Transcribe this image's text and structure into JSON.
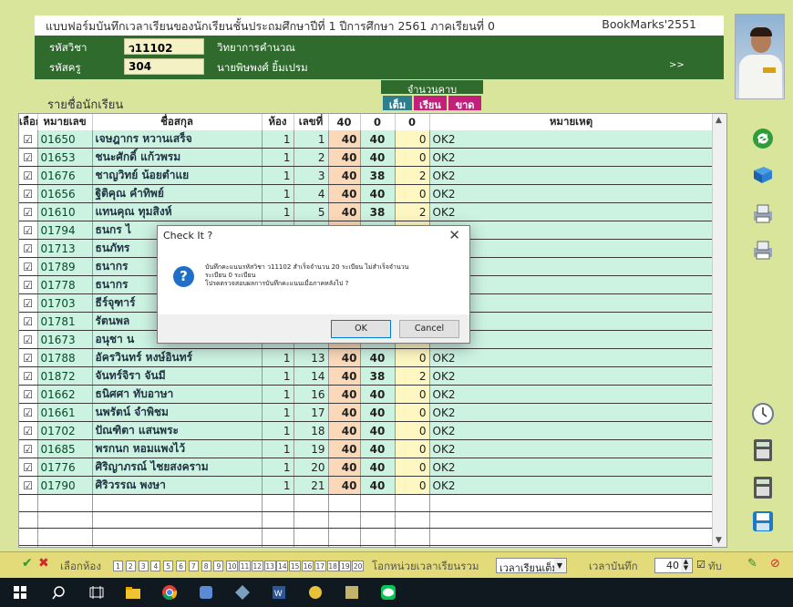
{
  "window": {
    "title": "แบบฟอร์มบันทึกเวลาเรียนของนักเรียนชั้นประถมศึกษาปีที่ 1   ปีการศึกษา 2561  ภาคเรียนที่ 0",
    "bookmark": "BookMarks'2551"
  },
  "header": {
    "subject_code_label": "รหัสวิชา",
    "subject_code": "ว11102",
    "subject_name": "วิทยาการคำนวณ",
    "teacher_code_label": "รหัสครู",
    "teacher_code": "304",
    "teacher_name": "นายพิษพงศ์ ยิ้มเปรม",
    "more_label": ">>"
  },
  "list_title": "รายชื่อนักเรียน",
  "periods": {
    "label": "จำนวนคาบ",
    "full_label": "เต็ม",
    "attend_label": "เรียน",
    "absent_label": "ขาด",
    "full_color": "#2e7f8d",
    "attend_color": "#c2207a",
    "absent_color": "#c2207a"
  },
  "columns": {
    "select": "เลือก",
    "id": "หมายเลข",
    "name": "ชื่อสกุล",
    "room": "ห้อง",
    "number": "เลขที่",
    "full": "40",
    "attend": "0",
    "absent": "0",
    "note": "หมายเหตุ"
  },
  "rows": [
    {
      "check": "☑",
      "id": "01650",
      "name": "เจษฎากร หวานเสร็จ",
      "room": "1",
      "no": "1",
      "full": "40",
      "attend": "40",
      "absent": "0",
      "note": "OK2"
    },
    {
      "check": "☑",
      "id": "01653",
      "name": "ชนะศักดิ์ แก้วพรม",
      "room": "1",
      "no": "2",
      "full": "40",
      "attend": "40",
      "absent": "0",
      "note": "OK2"
    },
    {
      "check": "☑",
      "id": "01676",
      "name": "ชาญวิทย์ น้อยตำแย",
      "room": "1",
      "no": "3",
      "full": "40",
      "attend": "38",
      "absent": "2",
      "note": "OK2"
    },
    {
      "check": "☑",
      "id": "01656",
      "name": "ฐิติคุณ คำทิพย์",
      "room": "1",
      "no": "4",
      "full": "40",
      "attend": "40",
      "absent": "0",
      "note": "OK2"
    },
    {
      "check": "☑",
      "id": "01610",
      "name": "แทนคุณ ทุมสิงห์",
      "room": "1",
      "no": "5",
      "full": "40",
      "attend": "38",
      "absent": "2",
      "note": "OK2"
    },
    {
      "check": "☑",
      "id": "01794",
      "name": "ธนกร ไ",
      "room": "",
      "no": "",
      "full": "",
      "attend": "",
      "absent": "0",
      "note": "OK2"
    },
    {
      "check": "☑",
      "id": "01713",
      "name": "ธนภัทร",
      "room": "",
      "no": "",
      "full": "",
      "attend": "",
      "absent": "0",
      "note": "OK2"
    },
    {
      "check": "☑",
      "id": "01789",
      "name": "ธนากร",
      "room": "",
      "no": "",
      "full": "",
      "attend": "",
      "absent": "2",
      "note": "OK2"
    },
    {
      "check": "☑",
      "id": "01778",
      "name": "ธนากร",
      "room": "",
      "no": "",
      "full": "",
      "attend": "",
      "absent": "0",
      "note": "OK2"
    },
    {
      "check": "☑",
      "id": "01703",
      "name": "ธีร์จุฑาร์",
      "room": "",
      "no": "",
      "full": "",
      "attend": "",
      "absent": "0",
      "note": "OK2"
    },
    {
      "check": "☑",
      "id": "01781",
      "name": "รัตนพล",
      "room": "",
      "no": "",
      "full": "",
      "attend": "",
      "absent": "2",
      "note": "OK2"
    },
    {
      "check": "☑",
      "id": "01673",
      "name": "อนุชา น",
      "room": "",
      "no": "",
      "full": "",
      "attend": "",
      "absent": "0",
      "note": "OK2"
    },
    {
      "check": "☑",
      "id": "01788",
      "name": "อัครวินทร์ หงษ์อินทร์",
      "room": "1",
      "no": "13",
      "full": "40",
      "attend": "40",
      "absent": "0",
      "note": "OK2"
    },
    {
      "check": "☑",
      "id": "01872",
      "name": "จันทร์จิรา จันมี",
      "room": "1",
      "no": "14",
      "full": "40",
      "attend": "38",
      "absent": "2",
      "note": "OK2"
    },
    {
      "check": "☑",
      "id": "01662",
      "name": "ธนิศศา ทับอาษา",
      "room": "1",
      "no": "16",
      "full": "40",
      "attend": "40",
      "absent": "0",
      "note": "OK2"
    },
    {
      "check": "☑",
      "id": "01661",
      "name": "นพรัตน์ จำพิชม",
      "room": "1",
      "no": "17",
      "full": "40",
      "attend": "40",
      "absent": "0",
      "note": "OK2"
    },
    {
      "check": "☑",
      "id": "01702",
      "name": "ปัณฑิตา แสนพระ",
      "room": "1",
      "no": "18",
      "full": "40",
      "attend": "40",
      "absent": "0",
      "note": "OK2"
    },
    {
      "check": "☑",
      "id": "01685",
      "name": "พรกนก หอมแพงไว้",
      "room": "1",
      "no": "19",
      "full": "40",
      "attend": "40",
      "absent": "0",
      "note": "OK2"
    },
    {
      "check": "☑",
      "id": "01776",
      "name": "ศิริญาภรณ์ ไชยสงคราม",
      "room": "1",
      "no": "20",
      "full": "40",
      "attend": "40",
      "absent": "0",
      "note": "OK2"
    },
    {
      "check": "☑",
      "id": "01790",
      "name": "ศิริวรรณ พงษา",
      "room": "1",
      "no": "21",
      "full": "40",
      "attend": "40",
      "absent": "0",
      "note": "OK2"
    }
  ],
  "dialog": {
    "title": "Check It ?",
    "close": "✕",
    "icon": "?",
    "line1": "บันทึกคะแนนรหัสวิชา ว11102 สำเร็จจำนวน 20 ระเบียน  ไม่สำเร็จจำนวน",
    "line2": "ระเบียน 0 ระเบียน",
    "line3": "โปรดตรวจสอบผลการบันทึกคะแนนเมื่อภาคหลังไป ?",
    "ok": "OK",
    "cancel": "Cancel"
  },
  "bottom": {
    "select_room_label": "เลือกห้อง",
    "rooms": [
      "1",
      "2",
      "3",
      "4",
      "5",
      "6",
      "7",
      "8",
      "9",
      "10",
      "11",
      "12",
      "13",
      "14",
      "15",
      "16",
      "17",
      "18",
      "19",
      "20"
    ],
    "unit_label": "โอกหน่วยเวลาเรียนรวม",
    "dropdown_value": "เวลาเรียนเต็ม",
    "record_label": "เวลาบันทึก",
    "record_value": "40",
    "tab_label": "ทับ"
  }
}
